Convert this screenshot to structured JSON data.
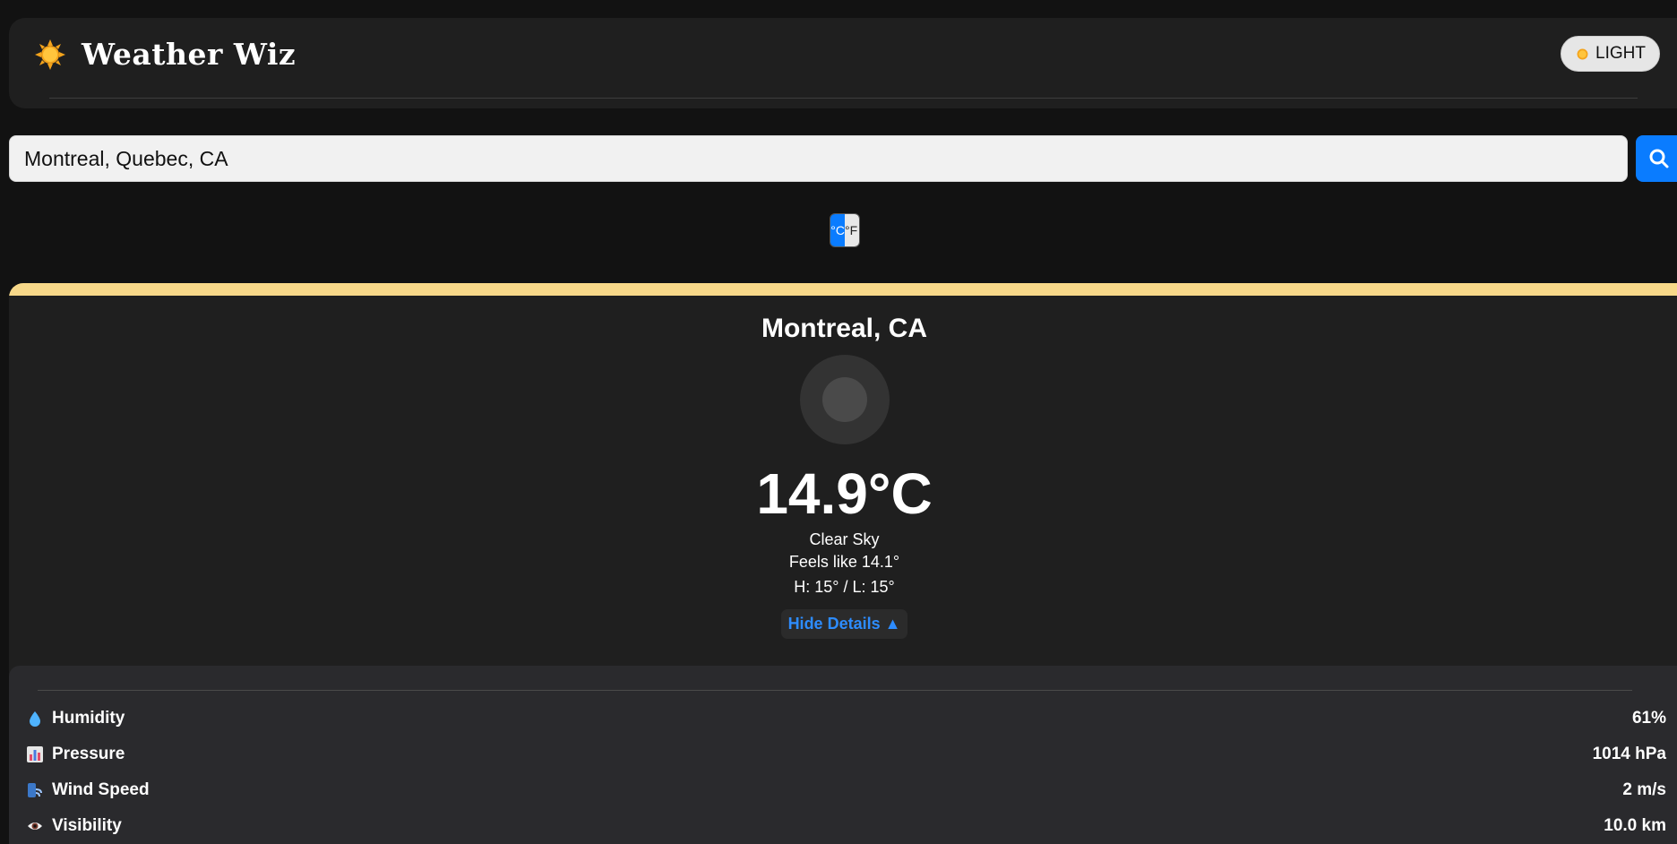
{
  "header": {
    "title": "Weather Wiz",
    "logo_icon": "sun-icon",
    "theme_toggle_label": "LIGHT",
    "theme_toggle_icon": "sun-icon"
  },
  "search": {
    "value": "Montreal, Quebec, CA",
    "button_icon": "search-icon"
  },
  "unit_toggle": {
    "celsius": "°C",
    "fahrenheit": "°F",
    "active": "°C"
  },
  "weather": {
    "city": "Montreal, CA",
    "icon": "weather-placeholder-icon",
    "temperature": "14.9°C",
    "description": "Clear Sky",
    "feels_like": "Feels like 14.1°",
    "high_low": "H: 15° / L: 15°",
    "details_toggle": "Hide Details ▲"
  },
  "details": [
    {
      "label": "Humidity",
      "value": "61%",
      "icon": "droplet-icon"
    },
    {
      "label": "Pressure",
      "value": "1014 hPa",
      "icon": "bar-chart-icon"
    },
    {
      "label": "Wind Speed",
      "value": "2 m/s",
      "icon": "wind-icon"
    },
    {
      "label": "Visibility",
      "value": "10.0 km",
      "icon": "eye-icon"
    }
  ],
  "colors": {
    "background": "#121212",
    "card": "#1f1f1f",
    "accent_bar": "#f7d889",
    "primary_blue": "#0a7cff",
    "link_blue": "#2d8cff"
  }
}
